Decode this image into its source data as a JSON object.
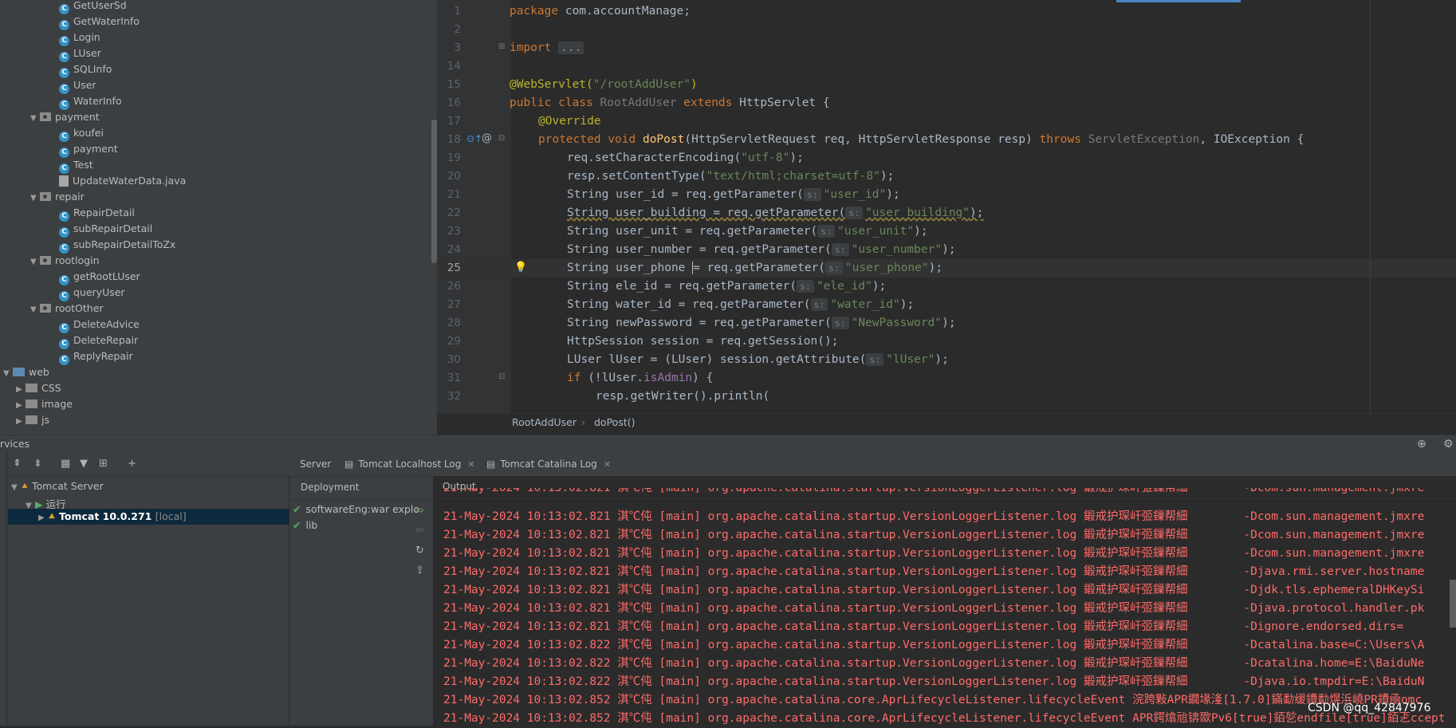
{
  "project_tree": {
    "items": [
      {
        "label": "GetUserSd",
        "type": "class"
      },
      {
        "label": "GetWaterInfo",
        "type": "class"
      },
      {
        "label": "Login",
        "type": "class"
      },
      {
        "label": "LUser",
        "type": "class"
      },
      {
        "label": "SQLInfo",
        "type": "class"
      },
      {
        "label": "User",
        "type": "class"
      },
      {
        "label": "WaterInfo",
        "type": "class"
      },
      {
        "label": "payment",
        "type": "package"
      },
      {
        "label": "koufei",
        "type": "class"
      },
      {
        "label": "payment",
        "type": "class"
      },
      {
        "label": "Test",
        "type": "class"
      },
      {
        "label": "UpdateWaterData.java",
        "type": "file"
      },
      {
        "label": "repair",
        "type": "package"
      },
      {
        "label": "RepairDetail",
        "type": "class"
      },
      {
        "label": "subRepairDetail",
        "type": "class"
      },
      {
        "label": "subRepairDetailToZx",
        "type": "class"
      },
      {
        "label": "rootlogin",
        "type": "package"
      },
      {
        "label": "getRootLUser",
        "type": "class"
      },
      {
        "label": "queryUser",
        "type": "class"
      },
      {
        "label": "rootOther",
        "type": "package"
      },
      {
        "label": "DeleteAdvice",
        "type": "class"
      },
      {
        "label": "DeleteRepair",
        "type": "class"
      },
      {
        "label": "ReplyRepair",
        "type": "class"
      },
      {
        "label": "web",
        "type": "web"
      },
      {
        "label": "CSS",
        "type": "folder"
      },
      {
        "label": "image",
        "type": "folder"
      },
      {
        "label": "js",
        "type": "folder"
      }
    ]
  },
  "editor": {
    "line_numbers": [
      "1",
      "2",
      "3",
      "14",
      "15",
      "16",
      "17",
      "18",
      "19",
      "20",
      "21",
      "22",
      "23",
      "24",
      "25",
      "26",
      "27",
      "28",
      "29",
      "30",
      "31",
      "32"
    ],
    "current_line": "25",
    "code": {
      "l1_kw": "package",
      "l1_rest": " com.accountManage;",
      "l3_kw": "import",
      "l3_fold": "...",
      "l15_ann": "@WebServlet(",
      "l15_str": "\"/rootAddUser\"",
      "l15_close": ")",
      "l16_kw1": "public",
      "l16_kw2": "class",
      "l16_name": "RootAddUser",
      "l16_kw3": "extends",
      "l16_parent": "HttpServlet {",
      "l17_ann": "@Override",
      "l18_kw1": "protected",
      "l18_kw2": "void",
      "l18_fn": "doPost",
      "l18_params": "(HttpServletRequest req, HttpServletResponse resp) ",
      "l18_kw3": "throws",
      "l18_exc1": "ServletException",
      "l18_rest": ", IOException {",
      "l19_pre": "req.setCharacterEncoding(",
      "l19_str": "\"utf-8\"",
      "l19_post": ");",
      "l20_pre": "resp.setContentType(",
      "l20_str": "\"text/html;charset=utf-8\"",
      "l20_post": ");",
      "l21_pre": "String user_id = req.getParameter(",
      "l21_str": "\"user_id\"",
      "l21_post": ");",
      "l22_pre": "String user_building = req.getParameter(",
      "l22_str": "\"user_building\"",
      "l22_post": ");",
      "l23_pre": "String user_unit = req.getParameter(",
      "l23_str": "\"user_unit\"",
      "l23_post": ");",
      "l24_pre": "String user_number = req.getParameter(",
      "l24_str": "\"user_number\"",
      "l24_post": ");",
      "l25_pre": "String user_phone ",
      "l25_caret": "=",
      "l25_mid": " req.getParameter(",
      "l25_str": "\"user_phone\"",
      "l25_post": ");",
      "l26_pre": "String ele_id = req.getParameter(",
      "l26_str": "\"ele_id\"",
      "l26_post": ");",
      "l27_pre": "String water_id = req.getParameter(",
      "l27_str": "\"water_id\"",
      "l27_post": ");",
      "l28_pre": "String newPassword = req.getParameter(",
      "l28_str": "\"NewPassword\"",
      "l28_post": ");",
      "l29": "HttpSession session = req.getSession();",
      "l30_pre": "LUser lUser = (LUser) session.getAttribute(",
      "l30_str": "\"lUser\"",
      "l30_post": ");",
      "l31_kw": "if",
      "l31_pre": " (!lUser.",
      "l31_field": "isAdmin",
      "l31_post": ") {",
      "l32": "resp.getWriter().println(",
      "param_hint": "s:"
    }
  },
  "breadcrumb": {
    "class": "RootAddUser",
    "sep": "›",
    "method": "doPost()"
  },
  "services": {
    "title": "rvices",
    "tree": {
      "server": "Tomcat Server",
      "group": "运行",
      "instance": "Tomcat 10.0.271",
      "instance_tag": "[local]"
    },
    "tabs": [
      {
        "label": "Server"
      },
      {
        "label": "Tomcat Localhost Log"
      },
      {
        "label": "Tomcat Catalina Log"
      }
    ],
    "deployment_header": "Deployment",
    "output_header": "Output",
    "deployments": [
      "softwareEng:war explo",
      "lib"
    ]
  },
  "log_lines": [
    {
      "ts": "21-May-2024 10:13:02.821",
      "lv": "淇℃伅",
      "src": "[main] org.apache.catalina.startup.VersionLoggerListener.log",
      "msg": "鍛戒护琛屽弬鏁帮細",
      "arg": "-Dcom.sun.management.jmxre"
    },
    {
      "ts": "21-May-2024 10:13:02.821",
      "lv": "淇℃伅",
      "src": "[main] org.apache.catalina.startup.VersionLoggerListener.log",
      "msg": "鍛戒护琛屽弬鏁帮細",
      "arg": "-Dcom.sun.management.jmxre"
    },
    {
      "ts": "21-May-2024 10:13:02.821",
      "lv": "淇℃伅",
      "src": "[main] org.apache.catalina.startup.VersionLoggerListener.log",
      "msg": "鍛戒护琛屽弬鏁帮細",
      "arg": "-Dcom.sun.management.jmxre"
    },
    {
      "ts": "21-May-2024 10:13:02.821",
      "lv": "淇℃伅",
      "src": "[main] org.apache.catalina.startup.VersionLoggerListener.log",
      "msg": "鍛戒护琛屽弬鏁帮細",
      "arg": "-Dcom.sun.management.jmxre"
    },
    {
      "ts": "21-May-2024 10:13:02.821",
      "lv": "淇℃伅",
      "src": "[main] org.apache.catalina.startup.VersionLoggerListener.log",
      "msg": "鍛戒护琛屽弬鏁帮細",
      "arg": "-Djava.rmi.server.hostname"
    },
    {
      "ts": "21-May-2024 10:13:02.821",
      "lv": "淇℃伅",
      "src": "[main] org.apache.catalina.startup.VersionLoggerListener.log",
      "msg": "鍛戒护琛屽弬鏁帮細",
      "arg": "-Djdk.tls.ephemeralDHKeySi"
    },
    {
      "ts": "21-May-2024 10:13:02.821",
      "lv": "淇℃伅",
      "src": "[main] org.apache.catalina.startup.VersionLoggerListener.log",
      "msg": "鍛戒护琛屽弬鏁帮細",
      "arg": "-Djava.protocol.handler.pk"
    },
    {
      "ts": "21-May-2024 10:13:02.821",
      "lv": "淇℃伅",
      "src": "[main] org.apache.catalina.startup.VersionLoggerListener.log",
      "msg": "鍛戒护琛屽弬鏁帮細",
      "arg": "-Dignore.endorsed.dirs="
    },
    {
      "ts": "21-May-2024 10:13:02.822",
      "lv": "淇℃伅",
      "src": "[main] org.apache.catalina.startup.VersionLoggerListener.log",
      "msg": "鍛戒护琛屽弬鏁帮細",
      "arg": "-Dcatalina.base=C:\\Users\\A"
    },
    {
      "ts": "21-May-2024 10:13:02.822",
      "lv": "淇℃伅",
      "src": "[main] org.apache.catalina.startup.VersionLoggerListener.log",
      "msg": "鍛戒护琛屽弬鏁帮細",
      "arg": "-Dcatalina.home=E:\\BaiduNe"
    },
    {
      "ts": "21-May-2024 10:13:02.822",
      "lv": "淇℃伅",
      "src": "[main] org.apache.catalina.startup.VersionLoggerListener.log",
      "msg": "鍛戒护琛屽弬鏁帮細",
      "arg": "-Djava.io.tmpdir=E:\\BaiduN"
    },
    {
      "ts": "21-May-2024 10:13:02.852",
      "lv": "淇℃伅",
      "src": "[main] org.apache.catalina.core.AprLifecycleListener.lifecycleEvent",
      "msg": "浣跨敤APR鐗堟湰[1.7.0]鏋勫缓鐨勫熀浜嶢PR鐨凾omc",
      "arg": ""
    },
    {
      "ts": "21-May-2024 10:13:02.852",
      "lv": "淇℃伅",
      "src": "[main] org.apache.catalina.core.AprLifecycleListener.lifecycleEvent",
      "msg": "APR鍔熻兘锛欼Pv6[true]銆乻endfile[true]銆乤ccept",
      "arg": ""
    }
  ],
  "first_log_partial": {
    "ts": "21-May-2024 10:13:02.821",
    "lv": "淇℃伅",
    "src": "[main] org.apache.catalina.startup.VersionLoggerListener.log",
    "msg": "鍛戒护琛屽弬鏁帮細",
    "arg": "-Dcom.sun.management.jmxre"
  },
  "watermark": "CSDN @qq_42847976"
}
